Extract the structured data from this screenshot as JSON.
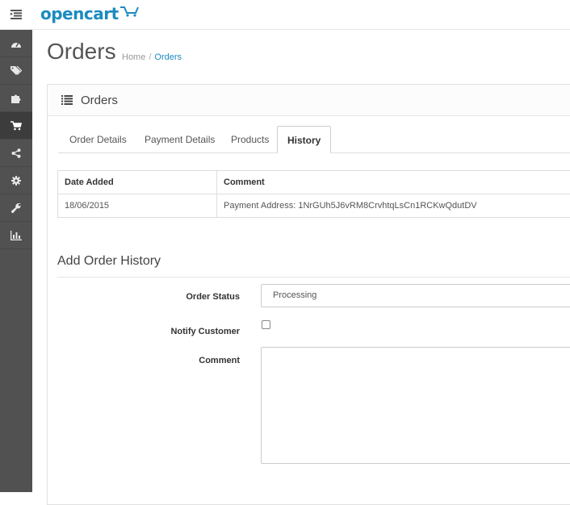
{
  "app": {
    "logo_text": "opencart"
  },
  "sidebar": {
    "items": [
      {
        "icon": "dashboard-icon"
      },
      {
        "icon": "tags-icon"
      },
      {
        "icon": "puzzle-icon"
      },
      {
        "icon": "shopping-cart-icon",
        "active": true
      },
      {
        "icon": "share-icon"
      },
      {
        "icon": "gear-icon"
      },
      {
        "icon": "wrench-icon"
      },
      {
        "icon": "bar-chart-icon"
      }
    ]
  },
  "page": {
    "title": "Orders",
    "breadcrumb": {
      "home": "Home",
      "separator": "/",
      "current": "Orders"
    }
  },
  "panel": {
    "title": "Orders",
    "tabs": [
      "Order Details",
      "Payment Details",
      "Products",
      "History"
    ],
    "active_tab": "History"
  },
  "history_table": {
    "headers": [
      "Date Added",
      "Comment"
    ],
    "rows": [
      [
        "18/06/2015",
        "Payment Address: 1NrGUh5J6vRM8CrvhtqLsCn1RCKwQdutDV"
      ]
    ]
  },
  "add_history": {
    "title": "Add Order History",
    "order_status_label": "Order Status",
    "order_status_value": "Processing",
    "notify_label": "Notify Customer",
    "comment_label": "Comment"
  },
  "colors": {
    "accent": "#1b8bc0",
    "sidebar": "#515151"
  }
}
